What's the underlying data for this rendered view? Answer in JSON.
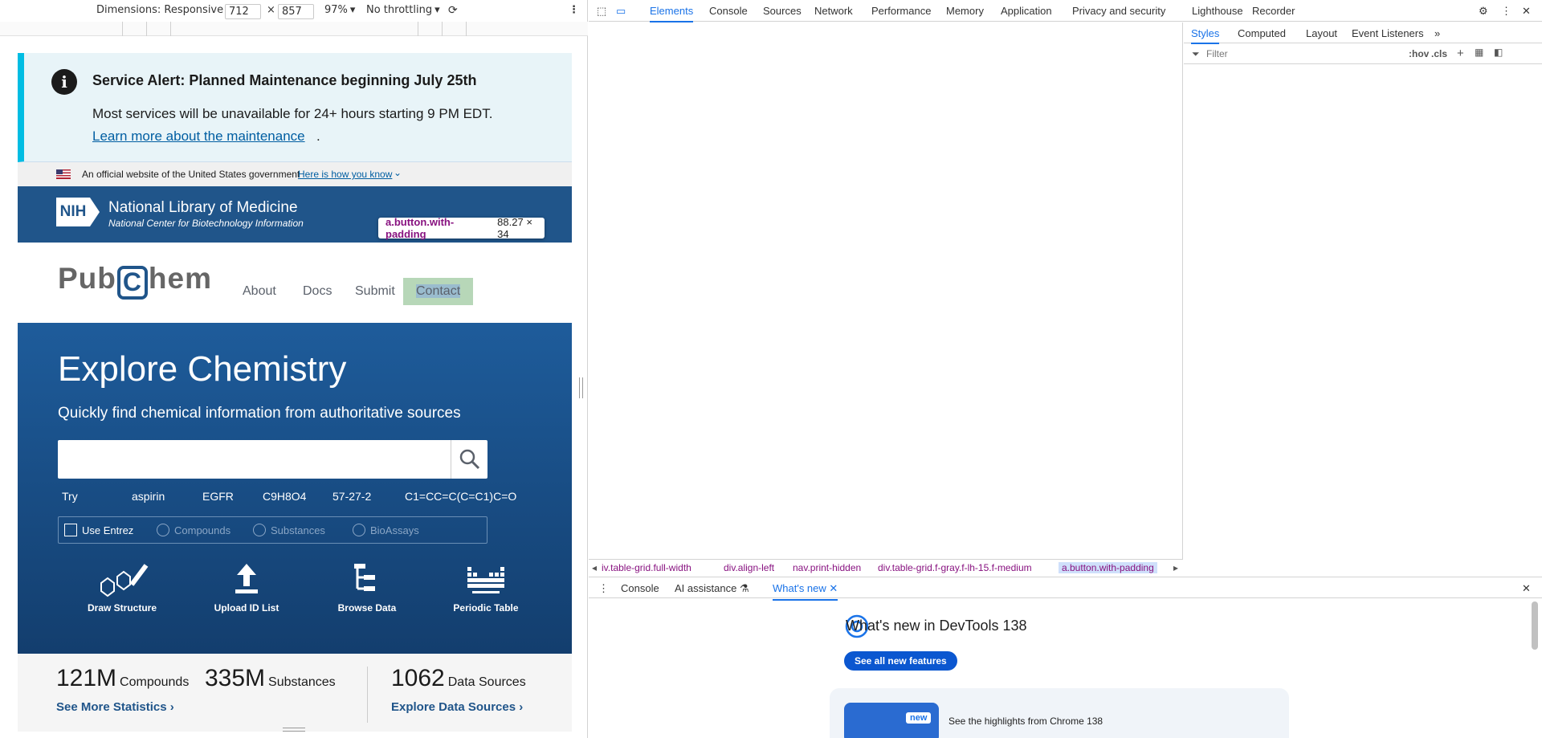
{
  "device_toolbar": {
    "dimensions_label": "Dimensions: Responsive",
    "width": "712",
    "height": "857",
    "zoom": "97%",
    "throttle": "No throttling"
  },
  "page": {
    "alert": {
      "title": "Service Alert: Planned Maintenance beginning July 25th",
      "body": "Most services will be unavailable for 24+ hours starting 9 PM EDT.",
      "link": "Learn more about the maintenance",
      "punct": "."
    },
    "gov": {
      "text": "An official website of the United States government",
      "link": "Here is how you know"
    },
    "nih": {
      "logo": "NIH",
      "title": "National Library of Medicine",
      "subtitle": "National Center for Biotechnology Information"
    },
    "logo": {
      "pre": "Pub",
      "hex": "C",
      "post": "hem"
    },
    "nav": [
      "About",
      "Docs",
      "Submit",
      "Contact"
    ],
    "tooltip": {
      "selector": "a.button.with-padding",
      "size": "88.27 × 34"
    },
    "hero": {
      "title": "Explore Chemistry",
      "subtitle": "Quickly find chemical information from authoritative sources",
      "try": "Try",
      "examples": [
        "aspirin",
        "EGFR",
        "C9H8O4",
        "57-27-2",
        "C1=CC=C(C=C1)C=O"
      ]
    },
    "entrez": {
      "checkbox": "Use Entrez",
      "radios": [
        "Compounds",
        "Substances",
        "BioAssays"
      ]
    },
    "tools": [
      "Draw Structure",
      "Upload ID List",
      "Browse Data",
      "Periodic Table"
    ],
    "stats": [
      {
        "num": "121M",
        "label": "Compounds"
      },
      {
        "num": "335M",
        "label": "Substances"
      },
      {
        "num": "1062",
        "label": "Data Sources"
      }
    ],
    "stats_links": [
      "See More Statistics",
      "Explore Data Sources"
    ]
  },
  "devtools": {
    "tabs": [
      "Elements",
      "Console",
      "Sources",
      "Network",
      "Performance",
      "Memory",
      "Application",
      "Privacy and security",
      "Lighthouse",
      "Recorder"
    ],
    "styles_tabs": [
      "Styles",
      "Computed",
      "Layout",
      "Event Listeners"
    ],
    "filter_placeholder": "Filter",
    "filter_tools": [
      ":hov",
      ".cls"
    ],
    "breadcrumbs": [
      "iv.table-grid.full-width",
      "div.align-left",
      "nav.print-hidden",
      "div.table-grid.f-gray.f-lh-15.f-medium",
      "a.button.with-padding"
    ],
    "drawer_tabs": [
      "Console",
      "AI assistance",
      "What's new"
    ],
    "whats_new": {
      "title": "What's new in DevTools 138",
      "button": "See all new features",
      "badge": "new",
      "highlight": "See the highlights from Chrome 138"
    }
  }
}
